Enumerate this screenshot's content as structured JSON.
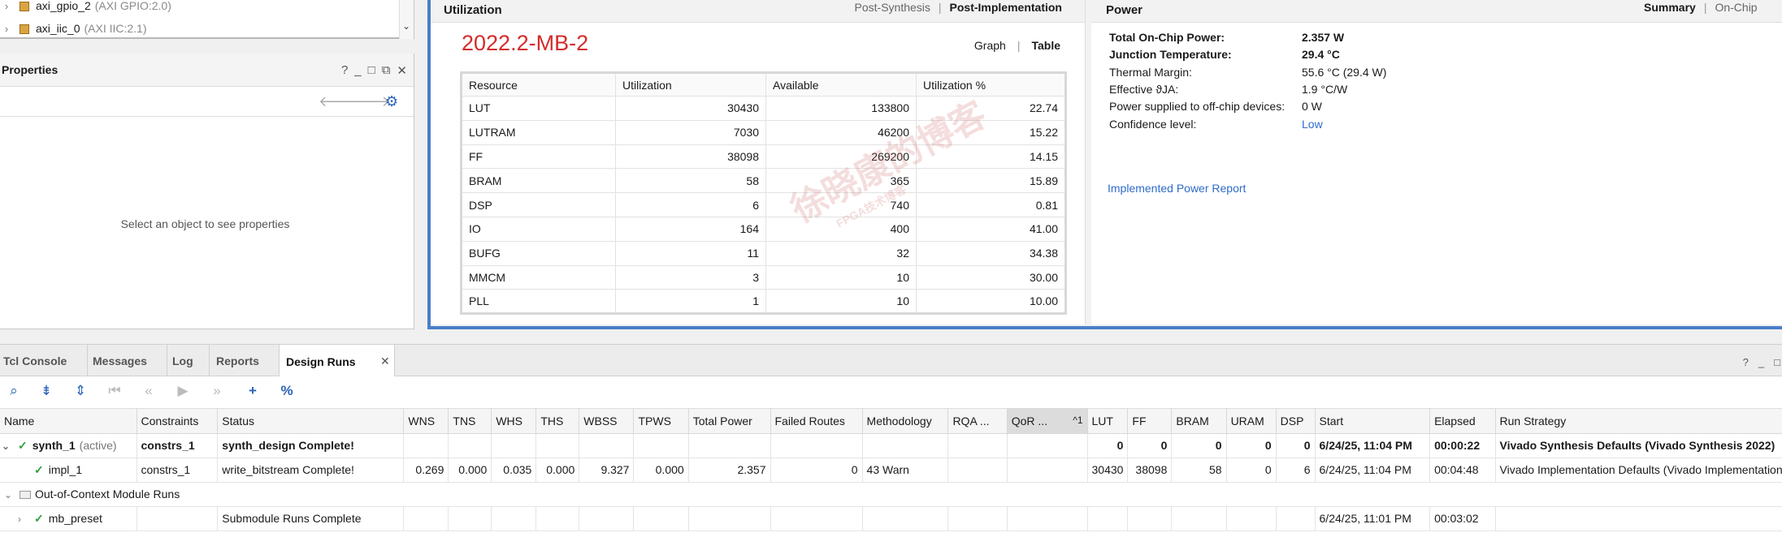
{
  "tree": {
    "items": [
      {
        "name": "axi_gpio_2",
        "ip": "(AXI GPIO:2.0)"
      },
      {
        "name": "axi_iic_0",
        "ip": "(AXI IIC:2.1)"
      }
    ]
  },
  "properties": {
    "title": "Properties",
    "controls": [
      "?",
      "_",
      "□",
      "⧉",
      "✕"
    ],
    "empty_text": "Select an object to see properties"
  },
  "utilization": {
    "title": "Utilization",
    "tabs": [
      "Post-Synthesis",
      "Post-Implementation"
    ],
    "selected_tab": "Post-Implementation",
    "board_label": "2022.2-MB-2",
    "view_tabs": [
      "Graph",
      "Table"
    ],
    "columns": [
      "Resource",
      "Utilization",
      "Available",
      "Utilization %"
    ],
    "rows": [
      [
        "LUT",
        "30430",
        "133800",
        "22.74"
      ],
      [
        "LUTRAM",
        "7030",
        "46200",
        "15.22"
      ],
      [
        "FF",
        "38098",
        "269200",
        "14.15"
      ],
      [
        "BRAM",
        "58",
        "365",
        "15.89"
      ],
      [
        "DSP",
        "6",
        "740",
        "0.81"
      ],
      [
        "IO",
        "164",
        "400",
        "41.00"
      ],
      [
        "BUFG",
        "11",
        "32",
        "34.38"
      ],
      [
        "MMCM",
        "3",
        "10",
        "30.00"
      ],
      [
        "PLL",
        "1",
        "10",
        "10.00"
      ]
    ]
  },
  "power": {
    "title": "Power",
    "tabs": [
      "Summary",
      "On-Chip"
    ],
    "rows": [
      {
        "k": "Total On-Chip Power:",
        "v": "2.357 W",
        "bold": true
      },
      {
        "k": "Junction Temperature:",
        "v": "29.4 °C",
        "bold": true
      },
      {
        "k": "Thermal Margin:",
        "v": "55.6 °C (29.4 W)",
        "bold": false
      },
      {
        "k": "Effective ϑJA:",
        "v": "1.9 °C/W",
        "bold": false
      },
      {
        "k": "Power supplied to off-chip devices:",
        "v": "0 W",
        "bold": false
      },
      {
        "k": "Confidence level:",
        "v": "Low",
        "bold": false,
        "link": true
      }
    ],
    "report_link": "Implemented Power Report"
  },
  "bottom_tabs": [
    "Tcl Console",
    "Messages",
    "Log",
    "Reports",
    "Design Runs"
  ],
  "selected_bottom_tab": "Design Runs",
  "runs": {
    "columns": [
      "Name",
      "Constraints",
      "Status",
      "WNS",
      "TNS",
      "WHS",
      "THS",
      "WBSS",
      "TPWS",
      "Total Power",
      "Failed Routes",
      "Methodology",
      "RQA ...",
      "QoR ...",
      "LUT",
      "FF",
      "BRAM",
      "URAM",
      "DSP",
      "Start",
      "Elapsed",
      "Run Strategy"
    ],
    "qor_sort": "^1",
    "rows": [
      {
        "name": "synth_1",
        "suffix": "(active)",
        "bold": true,
        "indent": 0,
        "cells": [
          "constrs_1",
          "synth_design Complete!",
          "",
          "",
          "",
          "",
          "",
          "",
          "",
          "",
          "",
          "",
          "",
          "0",
          "0",
          "0",
          "0",
          "0",
          "6/24/25, 11:04 PM",
          "00:00:22",
          "Vivado Synthesis Defaults (Vivado Synthesis 2022)"
        ]
      },
      {
        "name": "impl_1",
        "suffix": "",
        "bold": false,
        "indent": 1,
        "cells": [
          "constrs_1",
          "write_bitstream Complete!",
          "0.269",
          "0.000",
          "0.035",
          "0.000",
          "9.327",
          "0.000",
          "2.357",
          "0",
          "43 Warn",
          "",
          "",
          "30430",
          "38098",
          "58",
          "0",
          "6",
          "6/24/25, 11:04 PM",
          "00:04:48",
          "Vivado Implementation Defaults (Vivado Implementation"
        ]
      },
      {
        "name": "Out-of-Context Module Runs",
        "group": true
      },
      {
        "name": "mb_preset",
        "suffix": "",
        "bold": false,
        "indent": 1,
        "cells": [
          "",
          "Submodule Runs Complete",
          "",
          "",
          "",
          "",
          "",
          "",
          "",
          "",
          "",
          "",
          "",
          "",
          "",
          "",
          "",
          "",
          "6/24/25, 11:01 PM",
          "00:03:02",
          ""
        ]
      }
    ]
  },
  "colors": {
    "accent": "#4a7ec8",
    "board_label": "#d42b2b",
    "link": "#2f6bc9",
    "check": "#2e9e3c"
  }
}
